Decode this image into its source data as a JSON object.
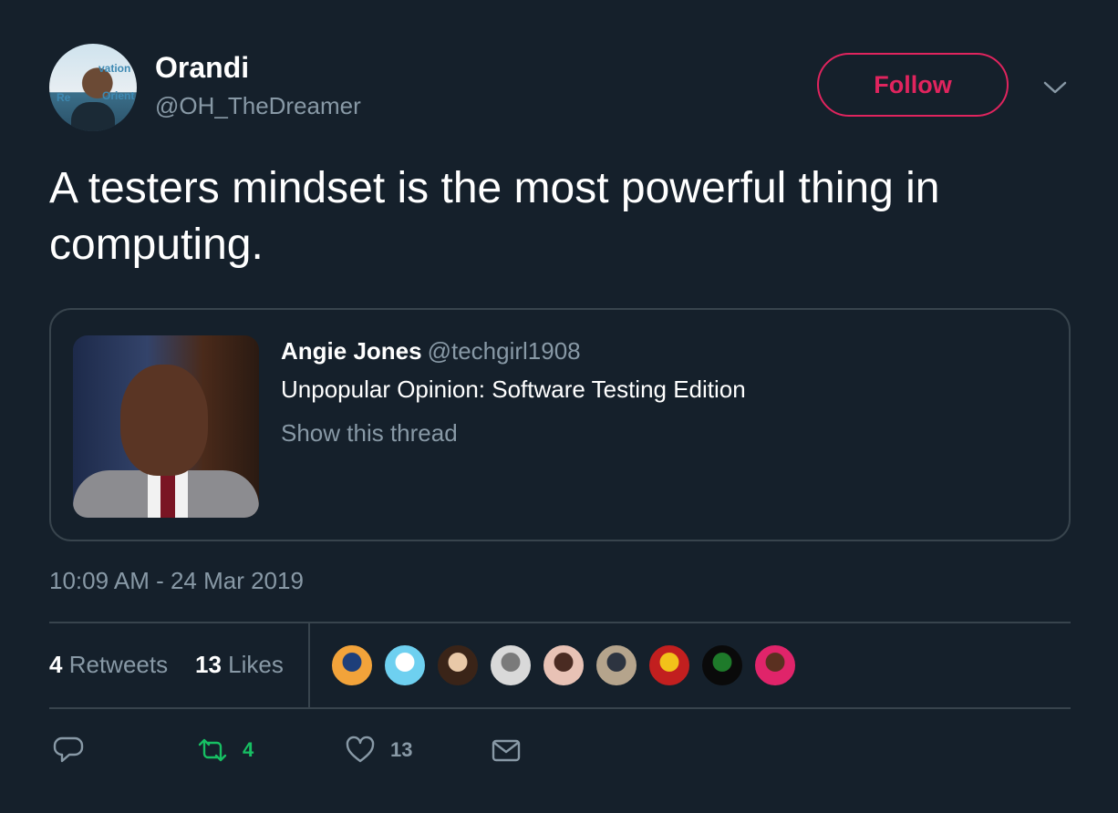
{
  "author": {
    "name": "Orandi",
    "handle": "@OH_TheDreamer",
    "avatar_text": [
      "vation",
      "Re",
      "Orient"
    ]
  },
  "follow_label": "Follow",
  "tweet_text": "A testers mindset is the most powerful thing in computing.",
  "quoted_tweet": {
    "name": "Angie Jones",
    "handle": "@techgirl1908",
    "text": "Unpopular Opinion: Software Testing Edition",
    "thread_link": "Show this thread"
  },
  "timestamp": "10:09 AM - 24 Mar 2019",
  "stats": {
    "retweets_count": "4",
    "retweets_label": "Retweets",
    "likes_count": "13",
    "likes_label": "Likes"
  },
  "liker_avatars": [
    {
      "colors": [
        "#f2a33a",
        "#1e3f7a"
      ]
    },
    {
      "colors": [
        "#6ed0f0",
        "#ffffff"
      ]
    },
    {
      "colors": [
        "#3a2418",
        "#e9c9a8"
      ]
    },
    {
      "colors": [
        "#d9d9d9",
        "#7a7a7a"
      ]
    },
    {
      "colors": [
        "#e8c2b5",
        "#4a2b22"
      ]
    },
    {
      "colors": [
        "#b5a48c",
        "#2d3440"
      ]
    },
    {
      "colors": [
        "#c21f1f",
        "#f2c21a"
      ]
    },
    {
      "colors": [
        "#0a0a0a",
        "#1e7a2a"
      ]
    },
    {
      "colors": [
        "#e0246a",
        "#5a3020"
      ]
    }
  ],
  "actions": {
    "retweet_count": "4",
    "like_count": "13"
  },
  "colors": {
    "background": "#15202b",
    "accent_red": "#e0245e",
    "muted": "#8899a6",
    "retweet_green": "#17bf63",
    "border": "#38444d"
  },
  "icons": {
    "caret": "chevron-down-icon",
    "reply": "reply-icon",
    "retweet": "retweet-icon",
    "like": "heart-icon",
    "message": "mail-icon"
  }
}
